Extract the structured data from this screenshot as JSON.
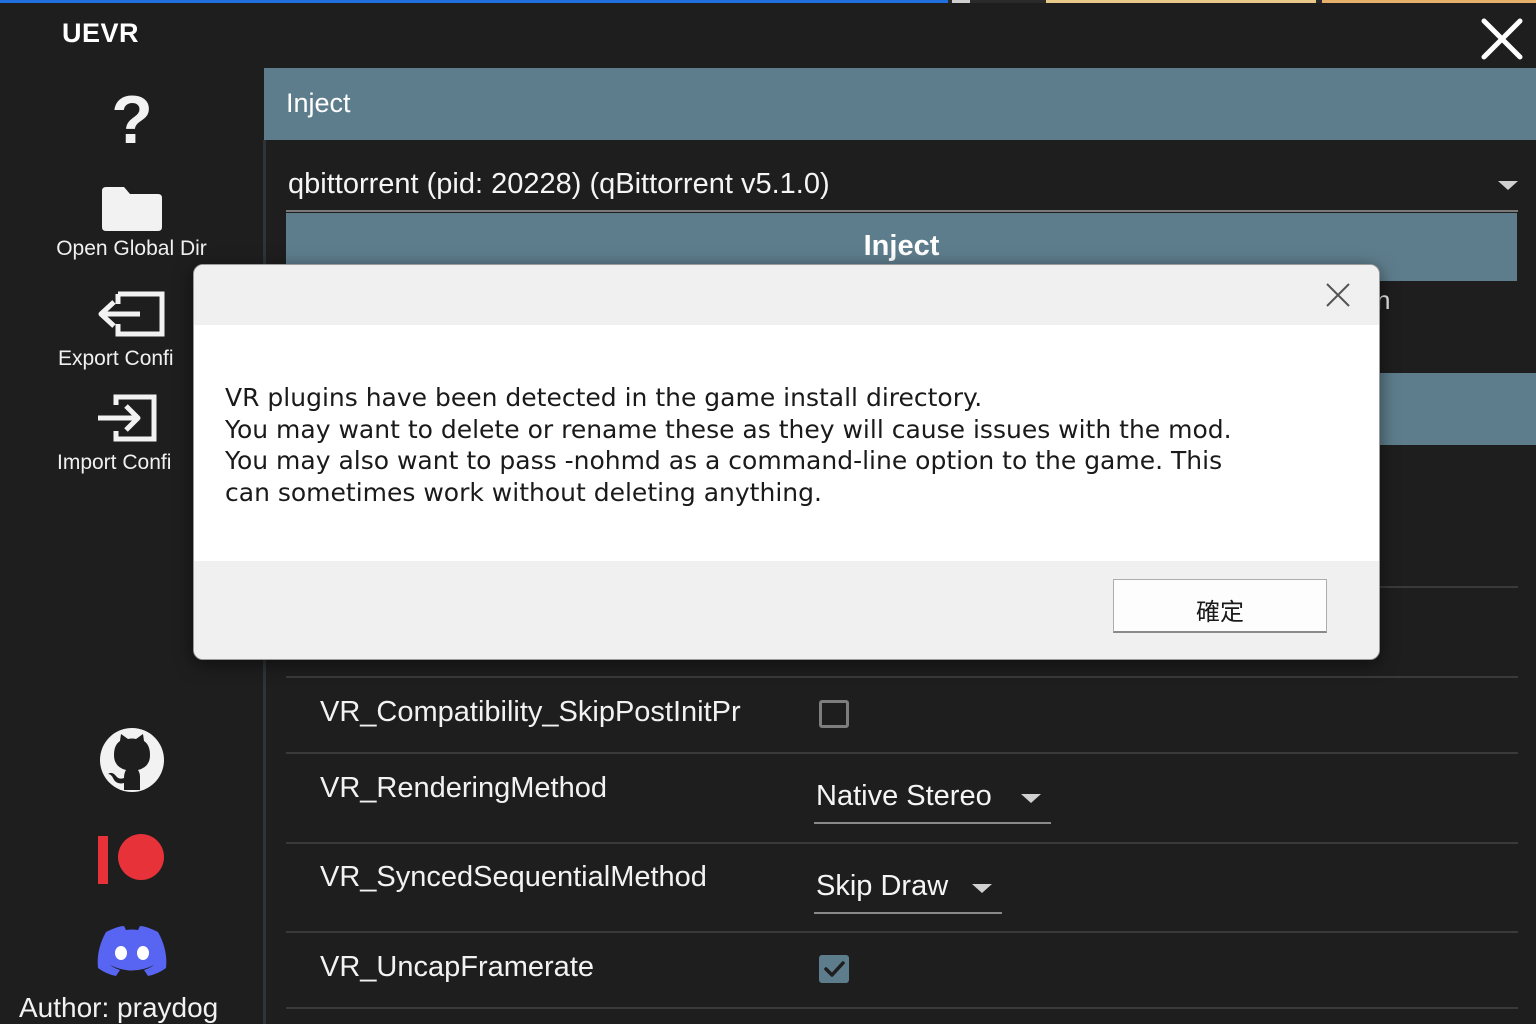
{
  "window": {
    "title": "UEVR",
    "close_icon": "close-icon"
  },
  "sidebar": {
    "help_glyph": "?",
    "items": [
      {
        "label": "Open Global Dir",
        "icon": "folder-icon"
      },
      {
        "label": "Export Confi",
        "icon": "export-icon"
      },
      {
        "label": "Import Confi",
        "icon": "import-icon"
      }
    ],
    "links": [
      {
        "icon": "github-icon"
      },
      {
        "icon": "patreon-icon",
        "color": "#e8323a"
      },
      {
        "icon": "discord-icon",
        "color": "#5865f2"
      }
    ],
    "author": "Author: praydog"
  },
  "main": {
    "header": "Inject",
    "process_selected": "qbittorrent (pid: 20228) (qBittorrent v5.1.0)",
    "inject_button": "Inject",
    "obscured_text": "n",
    "settings": [
      {
        "label": "VR_Compatibility_SkipPostInitPr",
        "type": "checkbox",
        "checked": false
      },
      {
        "label": "VR_RenderingMethod",
        "type": "dropdown",
        "value": "Native Stereo"
      },
      {
        "label": "VR_SyncedSequentialMethod",
        "type": "dropdown",
        "value": "Skip Draw"
      },
      {
        "label": "VR_UncapFramerate",
        "type": "checkbox",
        "checked": true
      }
    ]
  },
  "dialog": {
    "message_lines": [
      "VR plugins have been detected in the game install directory.",
      "You may want to delete or rename these as they will cause issues with the mod.",
      "You may also want to pass -nohmd as a command-line option to the game. This",
      "can sometimes work without deleting anything."
    ],
    "ok_button": "確定",
    "close_icon": "close-icon"
  },
  "colors": {
    "accent": "#5e7d8c",
    "background": "#1e1e1e"
  }
}
